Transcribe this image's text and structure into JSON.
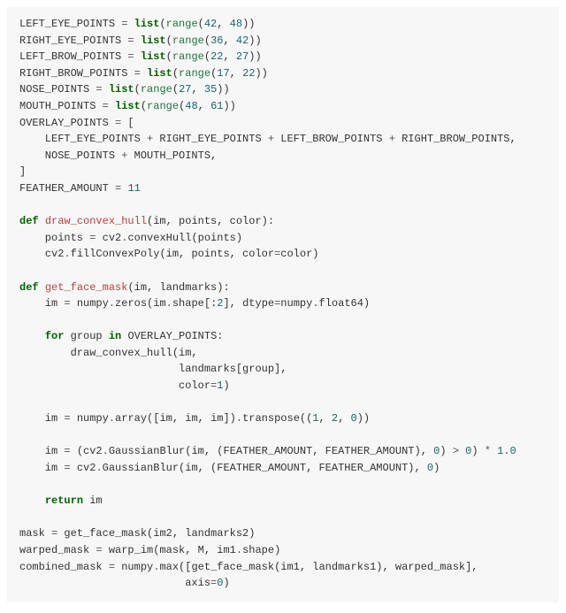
{
  "code": {
    "l01": {
      "a": "LEFT_EYE_POINTS ",
      "op": "=",
      "b": " ",
      "kw": "list",
      "c": "(",
      "fn": "range",
      "d": "(",
      "n1": "42",
      "e": ", ",
      "n2": "48",
      "f": "))"
    },
    "l02": {
      "a": "RIGHT_EYE_POINTS ",
      "op": "=",
      "b": " ",
      "kw": "list",
      "c": "(",
      "fn": "range",
      "d": "(",
      "n1": "36",
      "e": ", ",
      "n2": "42",
      "f": "))"
    },
    "l03": {
      "a": "LEFT_BROW_POINTS ",
      "op": "=",
      "b": " ",
      "kw": "list",
      "c": "(",
      "fn": "range",
      "d": "(",
      "n1": "22",
      "e": ", ",
      "n2": "27",
      "f": "))"
    },
    "l04": {
      "a": "RIGHT_BROW_POINTS ",
      "op": "=",
      "b": " ",
      "kw": "list",
      "c": "(",
      "fn": "range",
      "d": "(",
      "n1": "17",
      "e": ", ",
      "n2": "22",
      "f": "))"
    },
    "l05": {
      "a": "NOSE_POINTS ",
      "op": "=",
      "b": " ",
      "kw": "list",
      "c": "(",
      "fn": "range",
      "d": "(",
      "n1": "27",
      "e": ", ",
      "n2": "35",
      "f": "))"
    },
    "l06": {
      "a": "MOUTH_POINTS ",
      "op": "=",
      "b": " ",
      "kw": "list",
      "c": "(",
      "fn": "range",
      "d": "(",
      "n1": "48",
      "e": ", ",
      "n2": "61",
      "f": "))"
    },
    "l07": {
      "a": "OVERLAY_POINTS ",
      "op": "=",
      "b": " ["
    },
    "l08": {
      "a": "    LEFT_EYE_POINTS ",
      "op": "+",
      "b": " RIGHT_EYE_POINTS ",
      "op2": "+",
      "c": " LEFT_BROW_POINTS ",
      "op3": "+",
      "d": " RIGHT_BROW_POINTS,"
    },
    "l09": {
      "a": "    NOSE_POINTS ",
      "op": "+",
      "b": " MOUTH_POINTS,"
    },
    "l10": {
      "a": "]"
    },
    "l11": {
      "a": "FEATHER_AMOUNT ",
      "op": "=",
      "b": " ",
      "n": "11"
    },
    "l12": {
      "a": ""
    },
    "l13": {
      "kw": "def",
      "sp": " ",
      "fn": "draw_convex_hull",
      "a": "(im, points, color):"
    },
    "l14": {
      "a": "    points ",
      "op": "=",
      "b": " cv2",
      "dot": ".",
      "c": "convexHull(points)"
    },
    "l15": {
      "a": "    cv2",
      "dot": ".",
      "b": "fillConvexPoly(im, points, color",
      "op": "=",
      "c": "color)"
    },
    "l16": {
      "a": ""
    },
    "l17": {
      "kw": "def",
      "sp": " ",
      "fn": "get_face_mask",
      "a": "(im, landmarks):"
    },
    "l18": {
      "a": "    im ",
      "op": "=",
      "b": " numpy",
      "dot": ".",
      "c": "zeros(im",
      "dot2": ".",
      "d": "shape[:",
      "n": "2",
      "e": "], dtype",
      "op2": "=",
      "f": "numpy",
      "dot3": ".",
      "g": "float64)"
    },
    "l19": {
      "a": ""
    },
    "l20": {
      "a": "    ",
      "kw": "for",
      "b": " group ",
      "kw2": "in",
      "c": " OVERLAY_POINTS:"
    },
    "l21": {
      "a": "        draw_convex_hull(im,"
    },
    "l22": {
      "a": "                         landmarks[group],"
    },
    "l23": {
      "a": "                         color",
      "op": "=",
      "n": "1",
      "b": ")"
    },
    "l24": {
      "a": ""
    },
    "l25": {
      "a": "    im ",
      "op": "=",
      "b": " numpy",
      "dot": ".",
      "c": "array([im, im, im])",
      "dot2": ".",
      "d": "transpose((",
      "n1": "1",
      "e": ", ",
      "n2": "2",
      "f": ", ",
      "n3": "0",
      "g": "))"
    },
    "l26": {
      "a": ""
    },
    "l27": {
      "a": "    im ",
      "op": "=",
      "b": " (cv2",
      "dot": ".",
      "c": "GaussianBlur(im, (FEATHER_AMOUNT, FEATHER_AMOUNT), ",
      "n1": "0",
      "d": ") ",
      "gt": ">",
      "e": " ",
      "n2": "0",
      "f": ") ",
      "star": "*",
      "g": " ",
      "n3": "1.0"
    },
    "l28": {
      "a": "    im ",
      "op": "=",
      "b": " cv2",
      "dot": ".",
      "c": "GaussianBlur(im, (FEATHER_AMOUNT, FEATHER_AMOUNT), ",
      "n": "0",
      "d": ")"
    },
    "l29": {
      "a": ""
    },
    "l30": {
      "a": "    ",
      "kw": "return",
      "b": " im"
    },
    "l31": {
      "a": ""
    },
    "l32": {
      "a": "mask ",
      "op": "=",
      "b": " get_face_mask(im2, landmarks2)"
    },
    "l33": {
      "a": "warped_mask ",
      "op": "=",
      "b": " warp_im(mask, M, im1",
      "dot": ".",
      "c": "shape)"
    },
    "l34": {
      "a": "combined_mask ",
      "op": "=",
      "b": " numpy",
      "dot": ".",
      "c": "max([get_face_mask(im1, landmarks1), warped_mask],"
    },
    "l35": {
      "a": "                          axis",
      "op": "=",
      "n": "0",
      "b": ")"
    }
  }
}
